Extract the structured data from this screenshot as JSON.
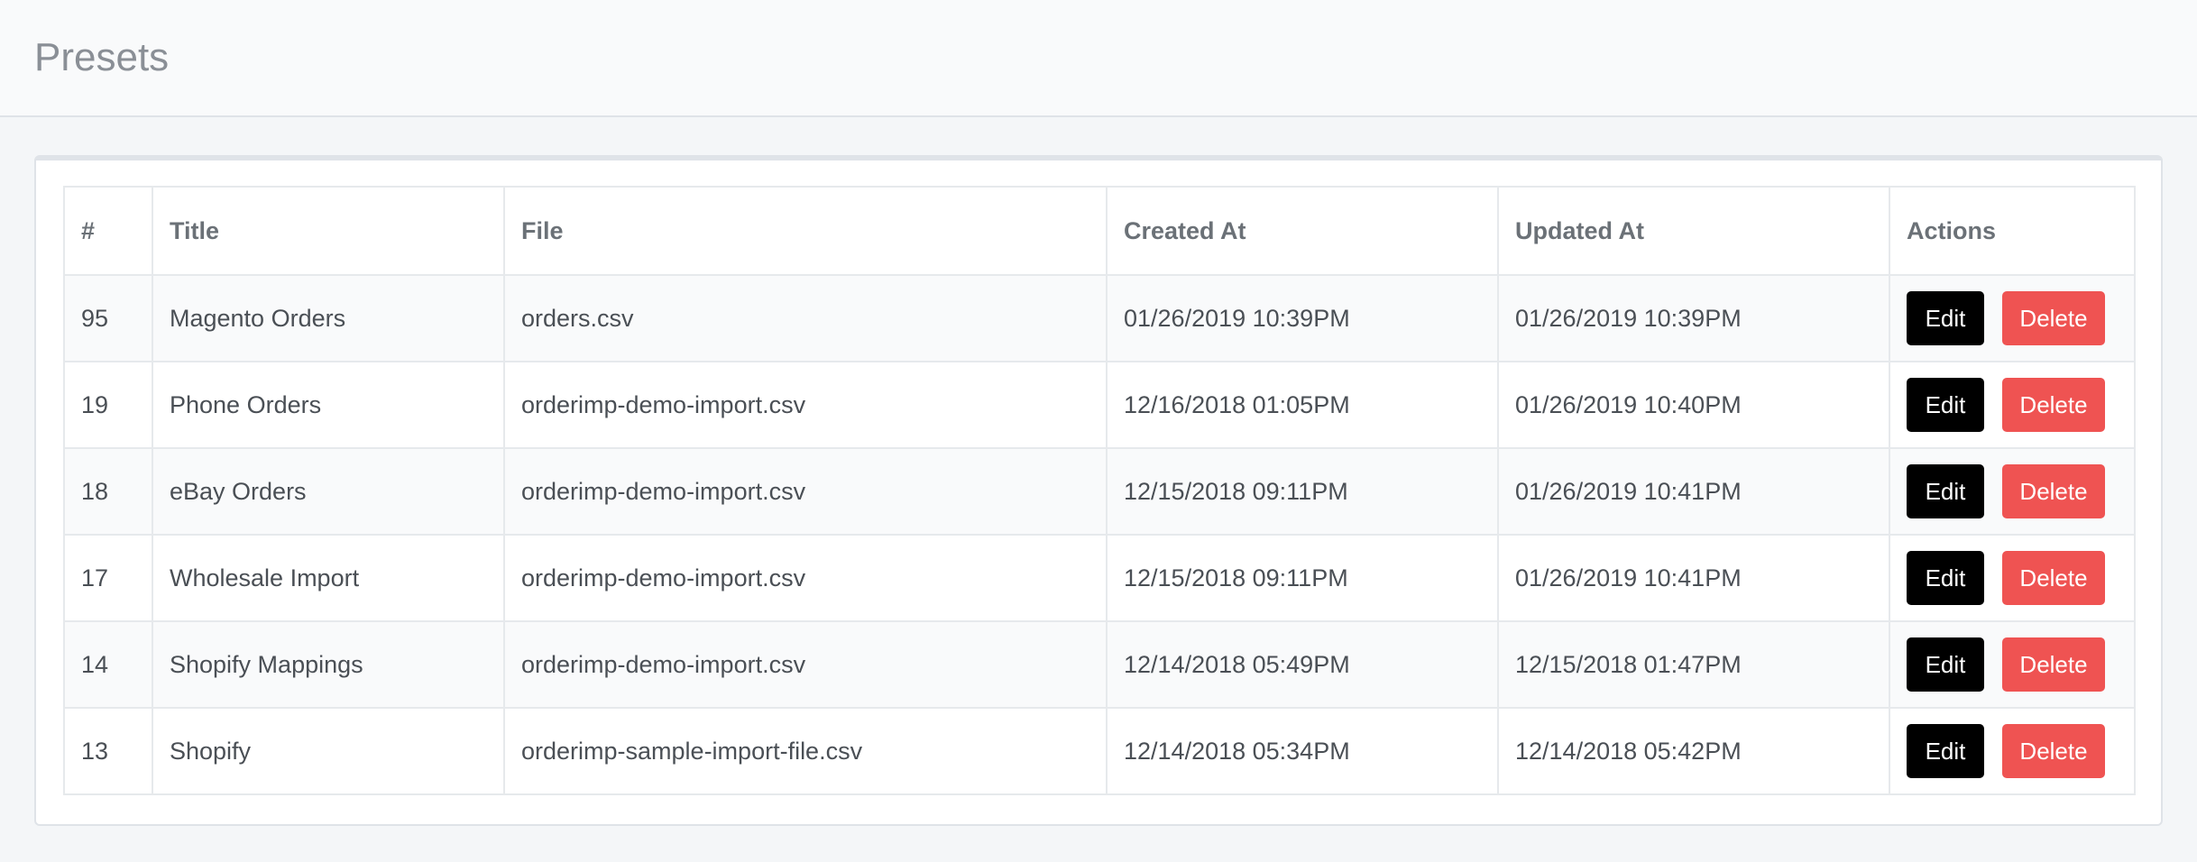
{
  "header": {
    "title": "Presets"
  },
  "table": {
    "columns": [
      "#",
      "Title",
      "File",
      "Created At",
      "Updated At",
      "Actions"
    ],
    "rows": [
      {
        "id": "95",
        "title": "Magento Orders",
        "file": "orders.csv",
        "created_at": "01/26/2019 10:39PM",
        "updated_at": "01/26/2019 10:39PM"
      },
      {
        "id": "19",
        "title": "Phone Orders",
        "file": "orderimp-demo-import.csv",
        "created_at": "12/16/2018 01:05PM",
        "updated_at": "01/26/2019 10:40PM"
      },
      {
        "id": "18",
        "title": "eBay Orders",
        "file": "orderimp-demo-import.csv",
        "created_at": "12/15/2018 09:11PM",
        "updated_at": "01/26/2019 10:41PM"
      },
      {
        "id": "17",
        "title": "Wholesale Import",
        "file": "orderimp-demo-import.csv",
        "created_at": "12/15/2018 09:11PM",
        "updated_at": "01/26/2019 10:41PM"
      },
      {
        "id": "14",
        "title": "Shopify Mappings",
        "file": "orderimp-demo-import.csv",
        "created_at": "12/14/2018 05:49PM",
        "updated_at": "12/15/2018 01:47PM"
      },
      {
        "id": "13",
        "title": "Shopify",
        "file": "orderimp-sample-import-file.csv",
        "created_at": "12/14/2018 05:34PM",
        "updated_at": "12/14/2018 05:42PM"
      }
    ],
    "actions": {
      "edit_label": "Edit",
      "delete_label": "Delete"
    }
  },
  "colors": {
    "edit_button": "#000000",
    "delete_button": "#ef5352",
    "page_background": "#f4f6f8"
  }
}
